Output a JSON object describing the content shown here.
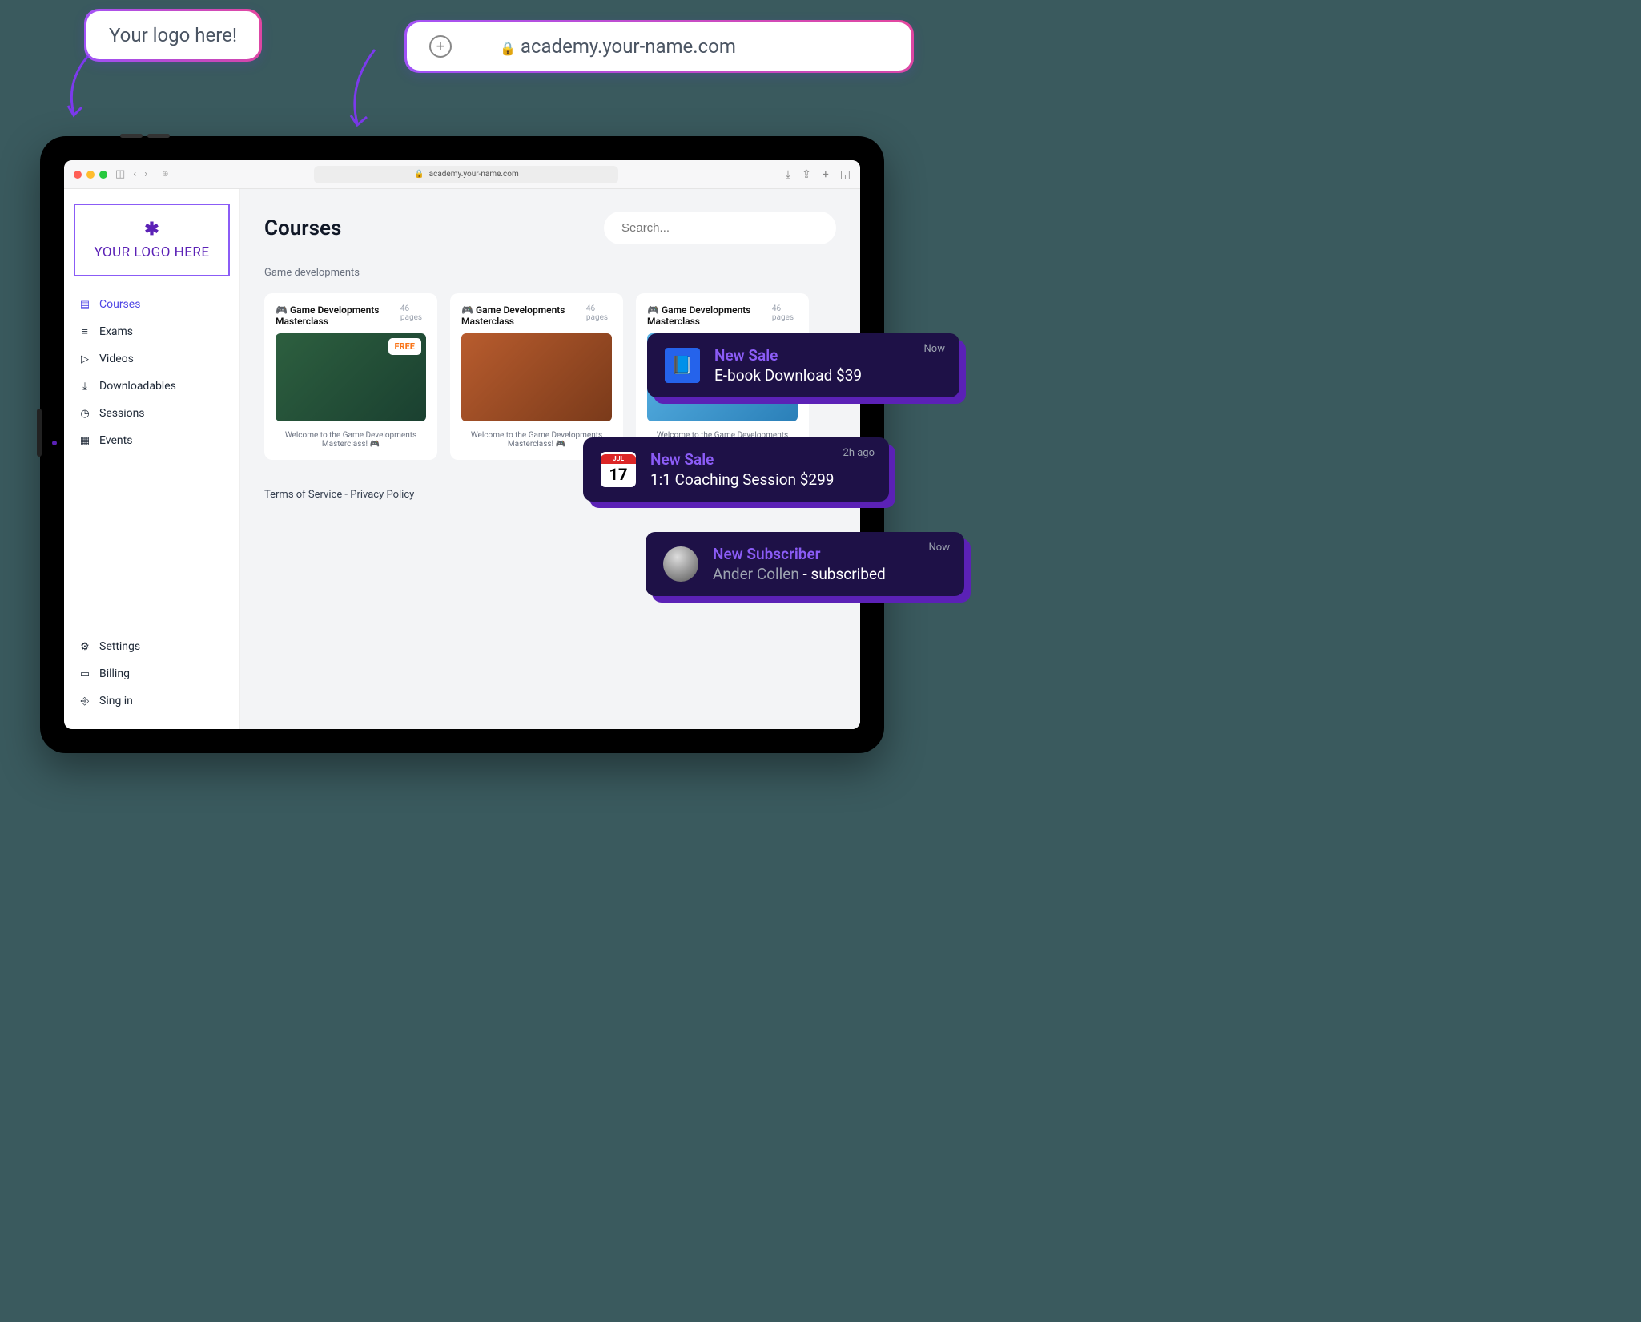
{
  "annotations": {
    "logo_hint": "Your logo here!",
    "url_display": "academy.your-name.com"
  },
  "browser": {
    "url": "academy.your-name.com"
  },
  "sidebar": {
    "logo_text": "YOUR LOGO HERE",
    "nav": [
      {
        "label": "Courses"
      },
      {
        "label": "Exams"
      },
      {
        "label": "Videos"
      },
      {
        "label": "Downloadables"
      },
      {
        "label": "Sessions"
      },
      {
        "label": "Events"
      }
    ],
    "bottom": [
      {
        "label": "Settings"
      },
      {
        "label": "Billing"
      },
      {
        "label": "Sing in"
      }
    ]
  },
  "main": {
    "title": "Courses",
    "search_placeholder": "Search...",
    "section": "Game developments",
    "cards": [
      {
        "title": "Game Developments Masterclass",
        "pages": "46 pages",
        "badge": "FREE",
        "desc": "Welcome to the Game Developments Masterclass! 🎮"
      },
      {
        "title": "Game Developments Masterclass",
        "pages": "46 pages",
        "badge": "",
        "desc": "Welcome to the Game Developments Masterclass! 🎮"
      },
      {
        "title": "Game Developments Masterclass",
        "pages": "46 pages",
        "badge": "",
        "desc": "Welcome to the Game Developments Masterclass! 🎮"
      }
    ],
    "footer": "Terms of Service - Privacy Policy"
  },
  "notifications": [
    {
      "title": "New Sale",
      "text": "E-book Download $39",
      "time": "Now",
      "cal_month": "",
      "cal_day": ""
    },
    {
      "title": "New Sale",
      "text": "1:1 Coaching Session $299",
      "time": "2h ago",
      "cal_month": "JUL",
      "cal_day": "17"
    },
    {
      "title": "New Subscriber",
      "text": "",
      "subscriber_name": "Ander Collen",
      "subscriber_action": " - subscribed",
      "time": "Now"
    }
  ]
}
